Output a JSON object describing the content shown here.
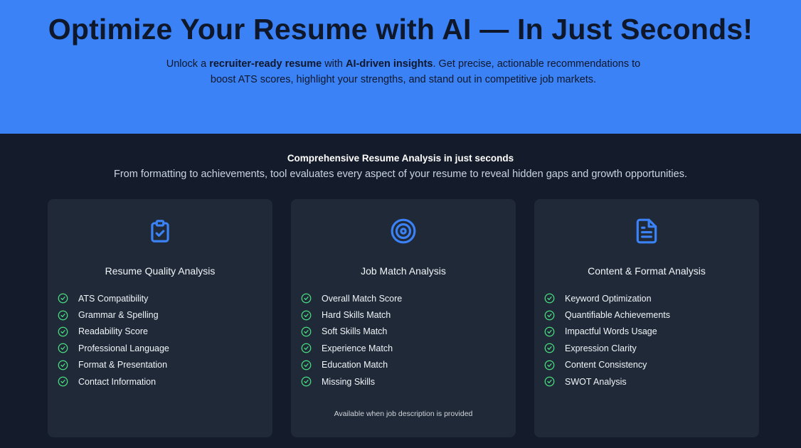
{
  "hero": {
    "title": "Optimize Your Resume with AI — In Just Seconds!",
    "subtitle_parts": {
      "p1": "Unlock a ",
      "b1": "recruiter-ready resume",
      "p2": " with ",
      "b2": "AI-driven insights",
      "p3": ". Get precise, actionable recommendations to boost ATS scores, highlight your strengths, and stand out in competitive job markets."
    }
  },
  "analysis": {
    "title": "Comprehensive Resume Analysis in just seconds",
    "description": "From formatting to achievements, tool evaluates every aspect of your resume to reveal hidden gaps and growth opportunities."
  },
  "cards": [
    {
      "icon": "clipboard-check-icon",
      "title": "Resume Quality Analysis",
      "items": [
        "ATS Compatibility",
        "Grammar & Spelling",
        "Readability Score",
        "Professional Language",
        "Format & Presentation",
        "Contact Information"
      ],
      "note": ""
    },
    {
      "icon": "target-icon",
      "title": "Job Match Analysis",
      "items": [
        "Overall Match Score",
        "Hard Skills Match",
        "Soft Skills Match",
        "Experience Match",
        "Education Match",
        "Missing Skills"
      ],
      "note": "Available when job description is provided"
    },
    {
      "icon": "document-icon",
      "title": "Content & Format Analysis",
      "items": [
        "Keyword Optimization",
        "Quantifiable Achievements",
        "Impactful Words Usage",
        "Expression Clarity",
        "Content Consistency",
        "SWOT Analysis"
      ],
      "note": ""
    }
  ],
  "colors": {
    "hero_bg": "#3b82f6",
    "dark_bg": "#141b2b",
    "card_bg": "#1f2937",
    "icon_accent": "#3b82f6",
    "check_accent": "#4ade80"
  }
}
